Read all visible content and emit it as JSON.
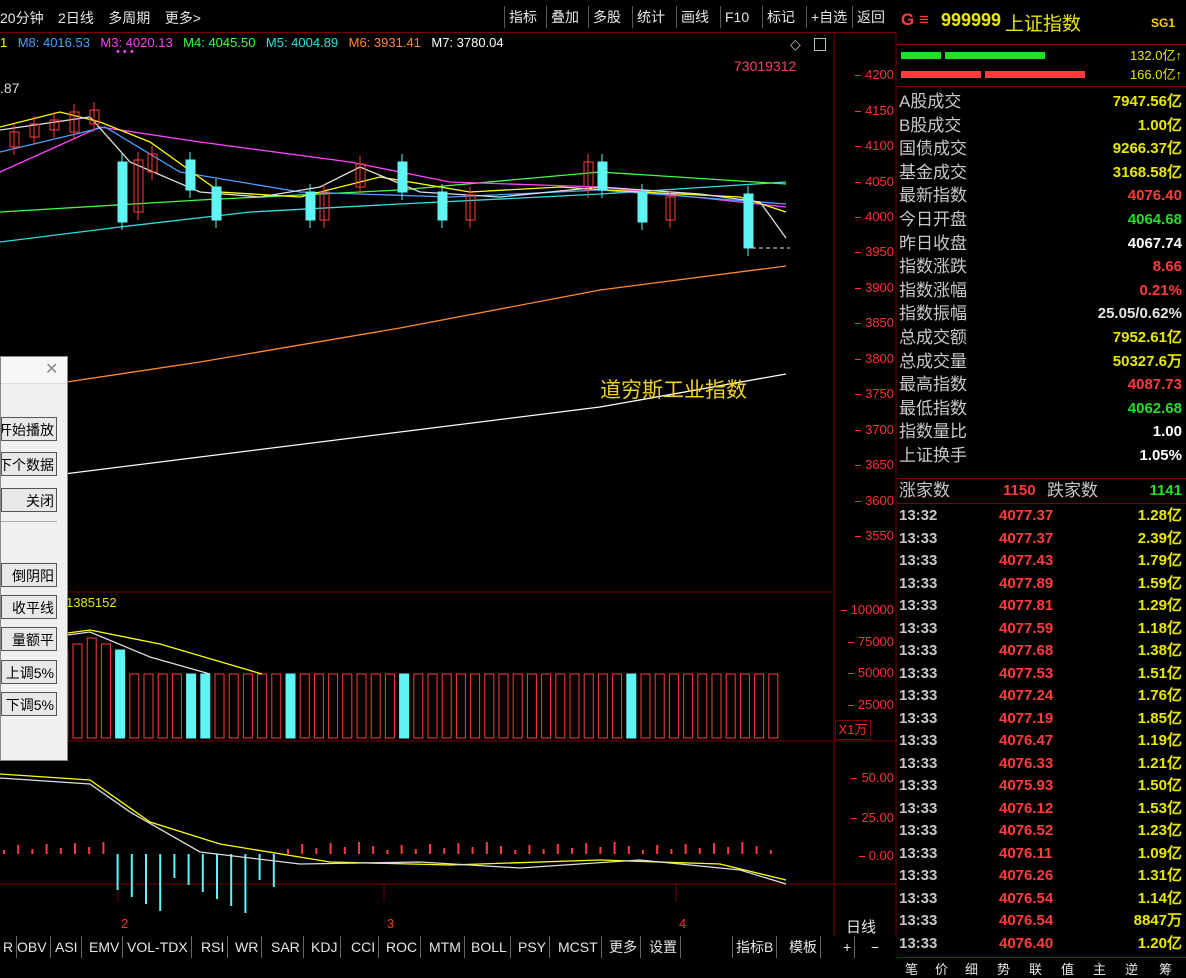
{
  "toolbar": {
    "left_items": [
      "20分钟",
      "2日线",
      "多周期",
      "更多>"
    ],
    "buttons": [
      "指标",
      "叠加",
      "多股",
      "统计",
      "画线",
      "F10",
      "标记",
      "+自选",
      "返回"
    ]
  },
  "ma_legend": {
    "m1": "1",
    "m8": "M8: 4016.53",
    "m3": "M3: 4020.13",
    "m4": "M4: 4045.50",
    "m5": "M5: 4004.89",
    "m6": "M6: 3931.41",
    "m7": "M7: 3780.04",
    "dots": "• • •"
  },
  "chart_labels": {
    "code_number": "73019312",
    "left_value": ".87",
    "overlay_name": "道穷斯工业指数",
    "vol_value": "1385152",
    "vol_unit": "X1万",
    "period": "日线"
  },
  "price_axis": [
    "4200",
    "4150",
    "4100",
    "4050",
    "4000",
    "3950",
    "3900",
    "3850",
    "3800",
    "3750",
    "3700",
    "3650",
    "3600",
    "3550"
  ],
  "vol_axis": [
    "100000",
    "75000",
    "50000",
    "25000"
  ],
  "osc_axis": [
    "50.00",
    "25.00",
    "0.00"
  ],
  "x_axis_labels": [
    "2",
    "3",
    "4"
  ],
  "indicator_tabs": [
    "R",
    "OBV",
    "ASI",
    "EMV",
    "VOL-TDX",
    "RSI",
    "WR",
    "SAR",
    "KDJ",
    "CCI",
    "ROC",
    "MTM",
    "BOLL",
    "PSY",
    "MCST",
    "更多",
    "设置"
  ],
  "right_tabs": [
    "指标B",
    "模板",
    "+",
    "−"
  ],
  "dialog": {
    "close": "✕",
    "buttons": [
      "开始播放",
      "下个数据",
      "关闭",
      "倒阴阳",
      "收平线",
      "量额平",
      "上调5%",
      "下调5%"
    ]
  },
  "quote": {
    "prefix": "G ≡",
    "code": "999999",
    "name": "上证指数",
    "badge": "SG1",
    "bar1_value": "132.0亿↑",
    "bar2_value": "166.0亿↑",
    "rows": [
      {
        "label": "A股成交",
        "value": "7947.56亿",
        "color": "#e8e800"
      },
      {
        "label": "B股成交",
        "value": "1.00亿",
        "color": "#e8e800"
      },
      {
        "label": "国债成交",
        "value": "9266.37亿",
        "color": "#e8e800"
      },
      {
        "label": "基金成交",
        "value": "3168.58亿",
        "color": "#e8e800"
      },
      {
        "label": "最新指数",
        "value": "4076.40",
        "color": "#ff3c3c"
      },
      {
        "label": "今日开盘",
        "value": "4064.68",
        "color": "#20e020"
      },
      {
        "label": "昨日收盘",
        "value": "4067.74",
        "color": "#ffffff"
      },
      {
        "label": "指数涨跌",
        "value": "8.66",
        "color": "#ff3c3c"
      },
      {
        "label": "指数涨幅",
        "value": "0.21%",
        "color": "#ff3c3c"
      },
      {
        "label": "指数振幅",
        "value": "25.05/0.62%",
        "color": "#e6e6e6"
      },
      {
        "label": "总成交额",
        "value": "7952.61亿",
        "color": "#e8e800"
      },
      {
        "label": "总成交量",
        "value": "50327.6万",
        "color": "#e8e800"
      },
      {
        "label": "最高指数",
        "value": "4087.73",
        "color": "#ff3c3c"
      },
      {
        "label": "最低指数",
        "value": "4062.68",
        "color": "#20e020"
      },
      {
        "label": "指数量比",
        "value": "1.00",
        "color": "#ffffff"
      },
      {
        "label": "上证换手",
        "value": "1.05%",
        "color": "#ffffff"
      }
    ],
    "up_label": "涨家数",
    "up_count": "1150",
    "down_label": "跌家数",
    "down_count": "1141"
  },
  "ticks": [
    {
      "time": "13:32",
      "price": "4077.37",
      "vol": "1.28亿"
    },
    {
      "time": "13:33",
      "price": "4077.37",
      "vol": "2.39亿"
    },
    {
      "time": "13:33",
      "price": "4077.43",
      "vol": "1.79亿"
    },
    {
      "time": "13:33",
      "price": "4077.89",
      "vol": "1.59亿"
    },
    {
      "time": "13:33",
      "price": "4077.81",
      "vol": "1.29亿"
    },
    {
      "time": "13:33",
      "price": "4077.59",
      "vol": "1.18亿"
    },
    {
      "time": "13:33",
      "price": "4077.68",
      "vol": "1.38亿"
    },
    {
      "time": "13:33",
      "price": "4077.53",
      "vol": "1.51亿"
    },
    {
      "time": "13:33",
      "price": "4077.24",
      "vol": "1.76亿"
    },
    {
      "time": "13:33",
      "price": "4077.19",
      "vol": "1.85亿"
    },
    {
      "time": "13:33",
      "price": "4076.47",
      "vol": "1.19亿"
    },
    {
      "time": "13:33",
      "price": "4076.33",
      "vol": "1.21亿"
    },
    {
      "time": "13:33",
      "price": "4075.93",
      "vol": "1.50亿"
    },
    {
      "time": "13:33",
      "price": "4076.12",
      "vol": "1.53亿"
    },
    {
      "time": "13:33",
      "price": "4076.52",
      "vol": "1.23亿"
    },
    {
      "time": "13:33",
      "price": "4076.11",
      "vol": "1.09亿"
    },
    {
      "time": "13:33",
      "price": "4076.26",
      "vol": "1.31亿"
    },
    {
      "time": "13:33",
      "price": "4076.54",
      "vol": "1.14亿"
    },
    {
      "time": "13:33",
      "price": "4076.54",
      "vol": "8847万"
    },
    {
      "time": "13:33",
      "price": "4076.40",
      "vol": "1.20亿"
    }
  ],
  "bottom_tabs": [
    "笔",
    "价",
    "细",
    "势",
    "联",
    "值",
    "主",
    "逆",
    "筹"
  ],
  "colors": {
    "up": "#ff3c3c",
    "down": "#20e020",
    "axis": "#ff3030",
    "bull_candle": "#ff3c3c",
    "bear_candle": "#5ff5f5"
  }
}
